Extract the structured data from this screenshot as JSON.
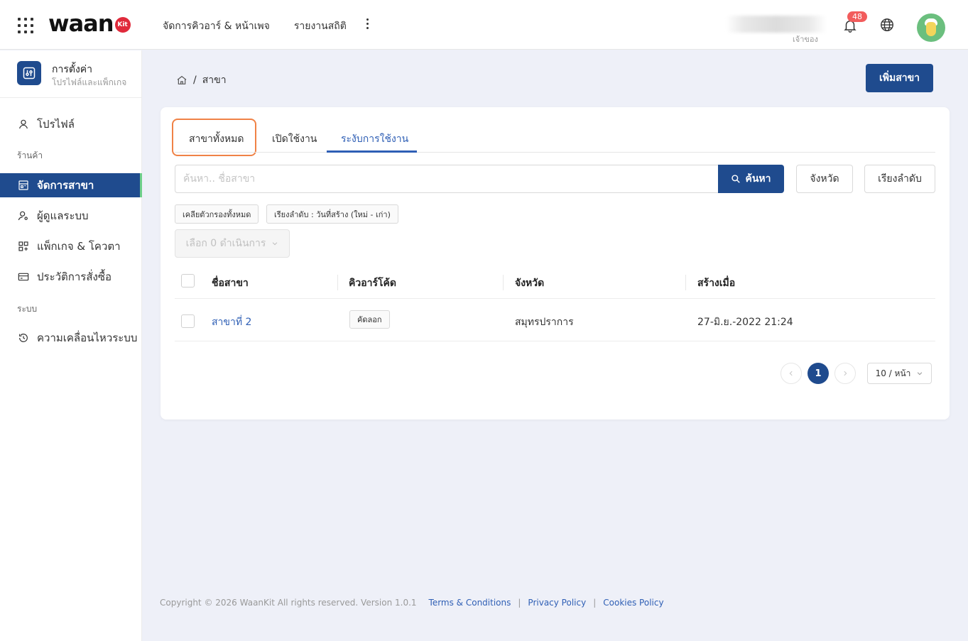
{
  "topbar": {
    "logo_text": "waan",
    "logo_badge": "Kit",
    "nav": [
      "จัดการคิวอาร์ & หน้าเพจ",
      "รายงานสถิติ"
    ],
    "user_role": "เจ้าของ",
    "notification_count": "48"
  },
  "sidebar": {
    "header_title": "การตั้งค่า",
    "header_subtitle": "โปรไฟล์และแพ็กเกจ",
    "profile": "โปรไฟล์",
    "section_shop": "ร้านค้า",
    "manage_branch": "จัดการสาขา",
    "admins": "ผู้ดูแลระบบ",
    "packages": "แพ็กเกจ & โควตา",
    "orders": "ประวัติการสั่งซื้อ",
    "section_system": "ระบบ",
    "activity": "ความเคลื่อนไหวระบบ"
  },
  "breadcrumb": {
    "current": "สาขา"
  },
  "actions": {
    "add_branch": "เพิ่มสาขา"
  },
  "tabs": [
    "สาขาทั้งหมด",
    "เปิดใช้งาน",
    "ระงับการใช้งาน"
  ],
  "search": {
    "placeholder": "ค้นหา.. ชื่อสาขา",
    "button": "ค้นหา",
    "province_button": "จังหวัด",
    "sort_button": "เรียงลำดับ"
  },
  "chips": {
    "clear": "เคลียตัวกรองทั้งหมด",
    "sort": "เรียงลำดับ : วันที่สร้าง (ใหม่ - เก่า)"
  },
  "bulk_action": "เลือก 0 ดำเนินการ",
  "table": {
    "headers": [
      "ชื่อสาขา",
      "คิวอาร์โค้ด",
      "จังหวัด",
      "สร้างเมื่อ"
    ],
    "rows": [
      {
        "name": "สาขาที่ 2",
        "qr": "คัดลอก",
        "province": "สมุทรปราการ",
        "created": "27-มิ.ย.-2022 21:24"
      }
    ]
  },
  "pagination": {
    "current": "1",
    "page_size": "10 / หน้า"
  },
  "footer": {
    "copyright": "Copyright © 2026 WaanKit All rights reserved. Version 1.0.1",
    "terms": "Terms & Conditions",
    "privacy": "Privacy Policy",
    "cookies": "Cookies Policy",
    "separator": "|"
  },
  "colors": {
    "primary": "#1f4b8e",
    "link": "#2f5fb5",
    "highlight": "#f08246",
    "badge": "#f25c5c"
  }
}
